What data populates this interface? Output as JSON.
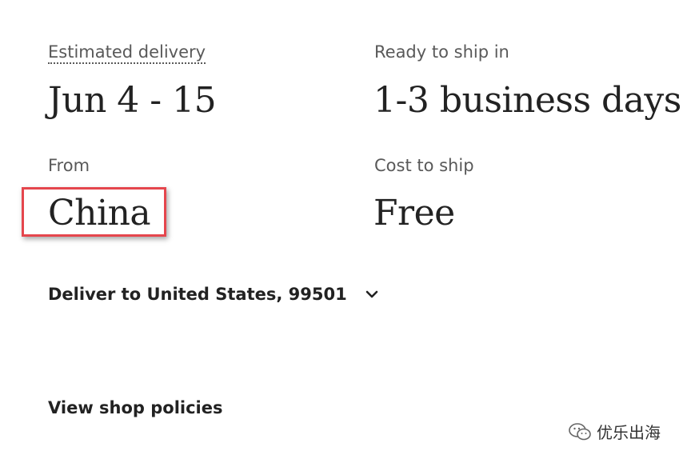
{
  "shipping": {
    "estimated_delivery_label": "Estimated delivery",
    "estimated_delivery_value": "Jun 4 - 15",
    "ready_to_ship_label": "Ready to ship in",
    "ready_to_ship_value": "1-3 business days",
    "from_label": "From",
    "from_value": "China",
    "cost_label": "Cost to ship",
    "cost_value": "Free"
  },
  "deliver_to": {
    "label": "Deliver to United States, 99501",
    "icon": "chevron-down-icon"
  },
  "links": {
    "view_shop_policies": "View shop policies"
  },
  "watermark": {
    "text": "优乐出海",
    "icon": "wechat-icon"
  },
  "colors": {
    "highlight_border": "#e5464d",
    "text_primary": "#222222",
    "text_secondary": "#595959"
  }
}
